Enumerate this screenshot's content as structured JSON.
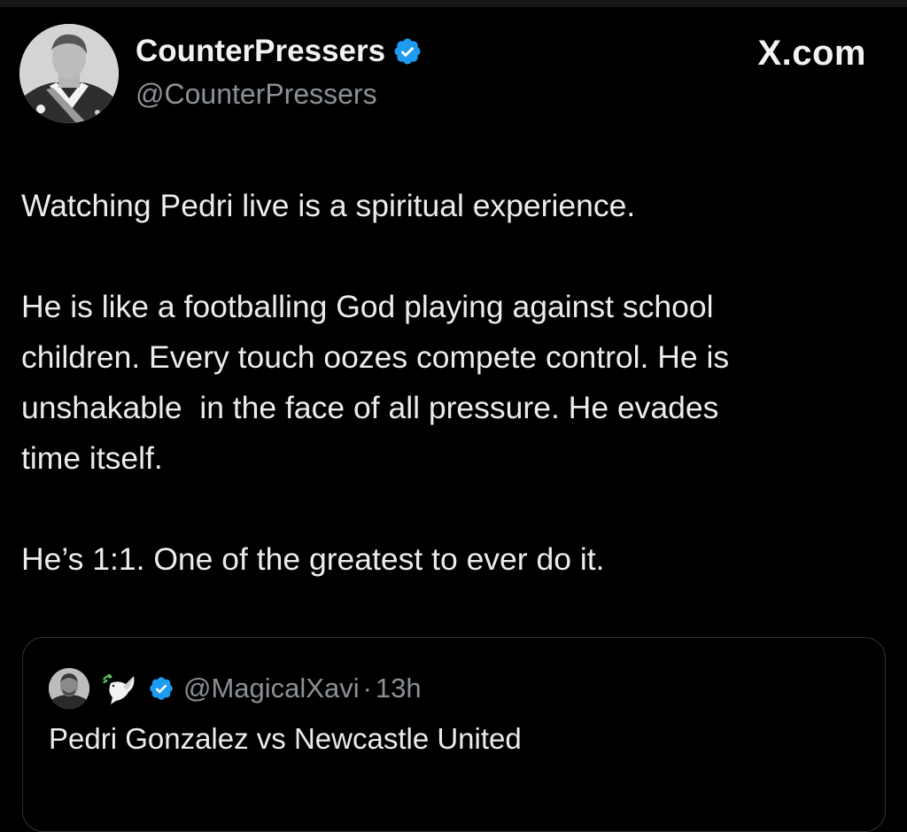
{
  "author": {
    "display_name": "CounterPressers",
    "handle": "@CounterPressers",
    "verified": true,
    "avatar_icon": "portrait-avatar"
  },
  "source_label": "X.com",
  "tweet": {
    "paragraphs": [
      "Watching Pedri live is a spiritual experience.",
      "He is like a footballing God playing against school\nchildren. Every touch oozes compete control. He is\nunshakable  in the face of all pressure. He evades\ntime itself.",
      "He’s 1:1. One of the greatest to ever do it."
    ]
  },
  "quoted_tweet": {
    "avatar_icon": "profile-photo-avatar",
    "emoji_icon": "dove-with-olive-branch-icon",
    "verified": true,
    "handle": "@MagicalXavi",
    "separator": "·",
    "time": "13h",
    "text": "Pedri Gonzalez vs Newcastle United"
  },
  "colors": {
    "background": "#000000",
    "text": "#e7e9ea",
    "secondary_text": "#8b9095",
    "verified_blue": "#1d9bf0",
    "card_border": "#2f3336"
  }
}
